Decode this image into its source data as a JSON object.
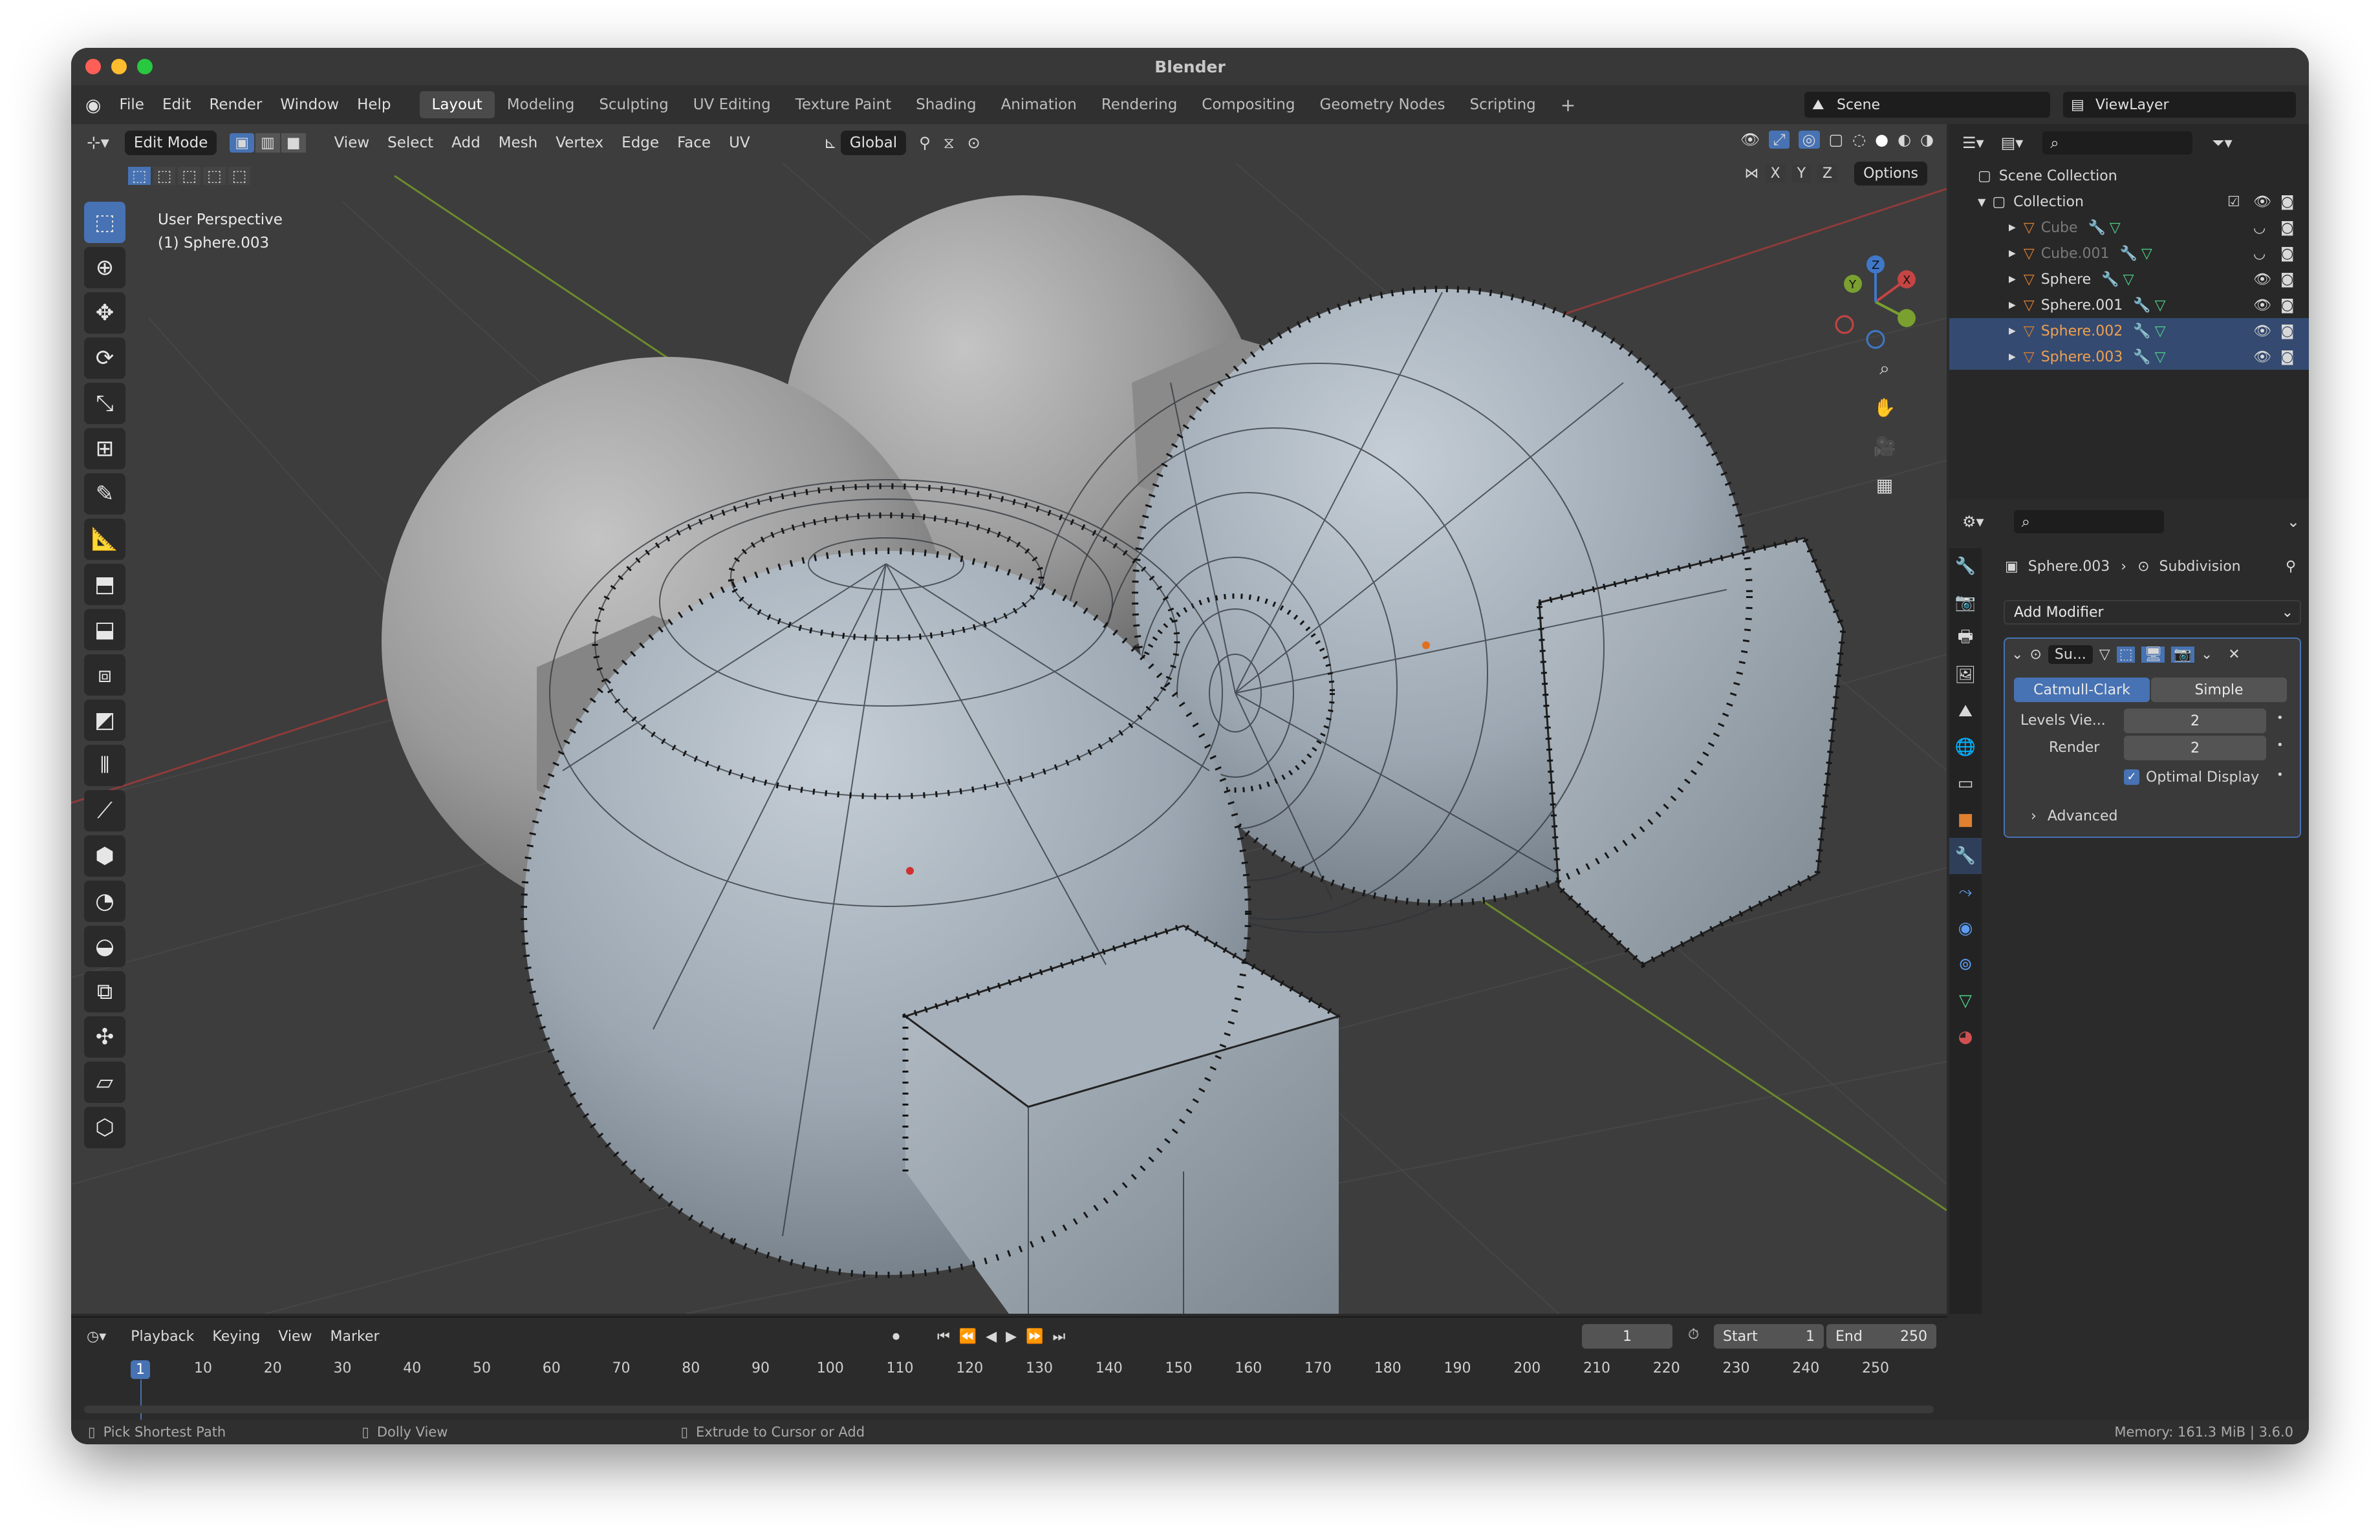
{
  "window": {
    "title": "Blender"
  },
  "menu": [
    "File",
    "Edit",
    "Render",
    "Window",
    "Help"
  ],
  "workspaces": [
    "Layout",
    "Modeling",
    "Sculpting",
    "UV Editing",
    "Texture Paint",
    "Shading",
    "Animation",
    "Rendering",
    "Compositing",
    "Geometry Nodes",
    "Scripting"
  ],
  "active_workspace": "Layout",
  "scene": {
    "name": "Scene",
    "view_layer": "ViewLayer"
  },
  "viewport": {
    "mode": "Edit Mode",
    "menus": [
      "View",
      "Select",
      "Add",
      "Mesh",
      "Vertex",
      "Edge",
      "Face",
      "UV"
    ],
    "orientation": "Global",
    "options_label": "Options",
    "axes": [
      "X",
      "Y",
      "Z"
    ],
    "info_line1": "User Perspective",
    "info_line2": "(1) Sphere.003"
  },
  "outliner": {
    "root": "Scene Collection",
    "collection": "Collection",
    "objects": [
      {
        "name": "Cube",
        "state": "hidden"
      },
      {
        "name": "Cube.001",
        "state": "hidden"
      },
      {
        "name": "Sphere",
        "state": "normal"
      },
      {
        "name": "Sphere.001",
        "state": "normal"
      },
      {
        "name": "Sphere.002",
        "state": "selected"
      },
      {
        "name": "Sphere.003",
        "state": "active"
      }
    ]
  },
  "properties": {
    "breadcrumb_object": "Sphere.003",
    "breadcrumb_modifier": "Subdivision",
    "add_modifier_label": "Add Modifier",
    "modifier_short_name": "Su...",
    "subdiv_types": [
      "Catmull-Clark",
      "Simple"
    ],
    "active_subdiv_type": "Catmull-Clark",
    "levels_viewport_label": "Levels Vie...",
    "levels_viewport": "2",
    "render_label": "Render",
    "render_levels": "2",
    "optimal_display_label": "Optimal Display",
    "optimal_display": true,
    "advanced_label": "Advanced"
  },
  "timeline": {
    "menus": [
      "Playback",
      "Keying",
      "View",
      "Marker"
    ],
    "current_frame": "1",
    "start_label": "Start",
    "start": "1",
    "end_label": "End",
    "end": "250",
    "ticks": [
      "1",
      "10",
      "20",
      "30",
      "40",
      "50",
      "60",
      "70",
      "80",
      "90",
      "100",
      "110",
      "120",
      "130",
      "140",
      "150",
      "160",
      "170",
      "180",
      "190",
      "200",
      "210",
      "220",
      "230",
      "240",
      "250"
    ]
  },
  "statusbar": {
    "hint1": "Pick Shortest Path",
    "hint2": "Dolly View",
    "hint3": "Extrude to Cursor or Add",
    "memory": "Memory: 161.3 MiB | 3.6.0"
  },
  "colors": {
    "accent": "#4772b3",
    "selected_text": "#f0a050",
    "grid_x": "#b03a3a",
    "grid_y": "#7a9a2a",
    "mesh": "#aeb8c2"
  }
}
